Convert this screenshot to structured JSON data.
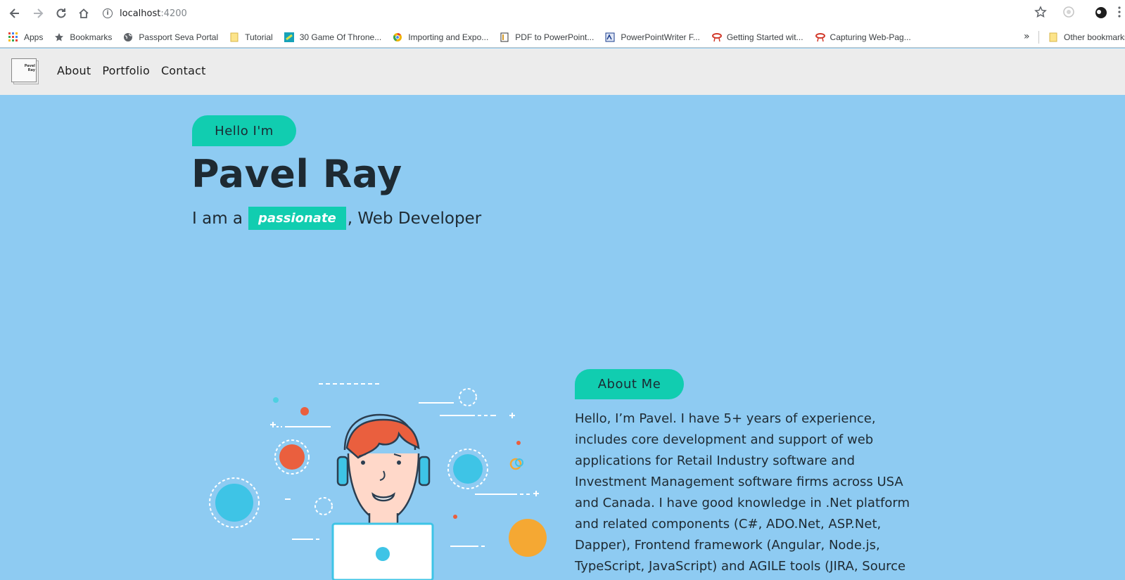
{
  "browser": {
    "url_host": "localhost",
    "url_port": ":4200",
    "bookmarks": [
      {
        "label": "Apps",
        "icon": "apps-grid-icon"
      },
      {
        "label": "Bookmarks",
        "icon": "star-icon"
      },
      {
        "label": "Passport Seva Portal",
        "icon": "globe-icon"
      },
      {
        "label": "Tutorial",
        "icon": "folder-icon"
      },
      {
        "label": "30 Game Of Throne...",
        "icon": "book-icon"
      },
      {
        "label": "Importing and Expo...",
        "icon": "chrome-icon"
      },
      {
        "label": "PDF to PowerPoint...",
        "icon": "document-icon"
      },
      {
        "label": "PowerPointWriter F...",
        "icon": "document-icon"
      },
      {
        "label": "Getting Started wit...",
        "icon": "ribbon-icon"
      },
      {
        "label": "Capturing Web-Pag...",
        "icon": "ribbon-icon"
      }
    ],
    "more_label": "»",
    "other_bookmarks": "Other bookmarks"
  },
  "site": {
    "logo_text": "Pavel Ray",
    "nav": [
      "About",
      "Portfolio",
      "Contact"
    ]
  },
  "hero": {
    "greeting": "Hello I'm",
    "name": "Pavel Ray",
    "tagline_prefix": "I am a",
    "tagline_highlight": "passionate",
    "tagline_suffix": ", Web Developer"
  },
  "about": {
    "heading": "About Me",
    "body": "Hello, I’m Pavel. I have 5+ years of experience, includes core development and support of web applications for Retail Industry software and Investment Management software firms across USA and Canada. I have good knowledge in .Net platform and related components (C#, ADO.Net, ASP.Net, Dapper), Frontend framework (Angular, Node.js, TypeScript, JavaScript) and AGILE tools (JIRA, Source"
  },
  "colors": {
    "page_bg": "#8ecbf2",
    "accent": "#11cdb0",
    "text_dark": "#1e2a32",
    "nav_bg": "#ececec"
  }
}
